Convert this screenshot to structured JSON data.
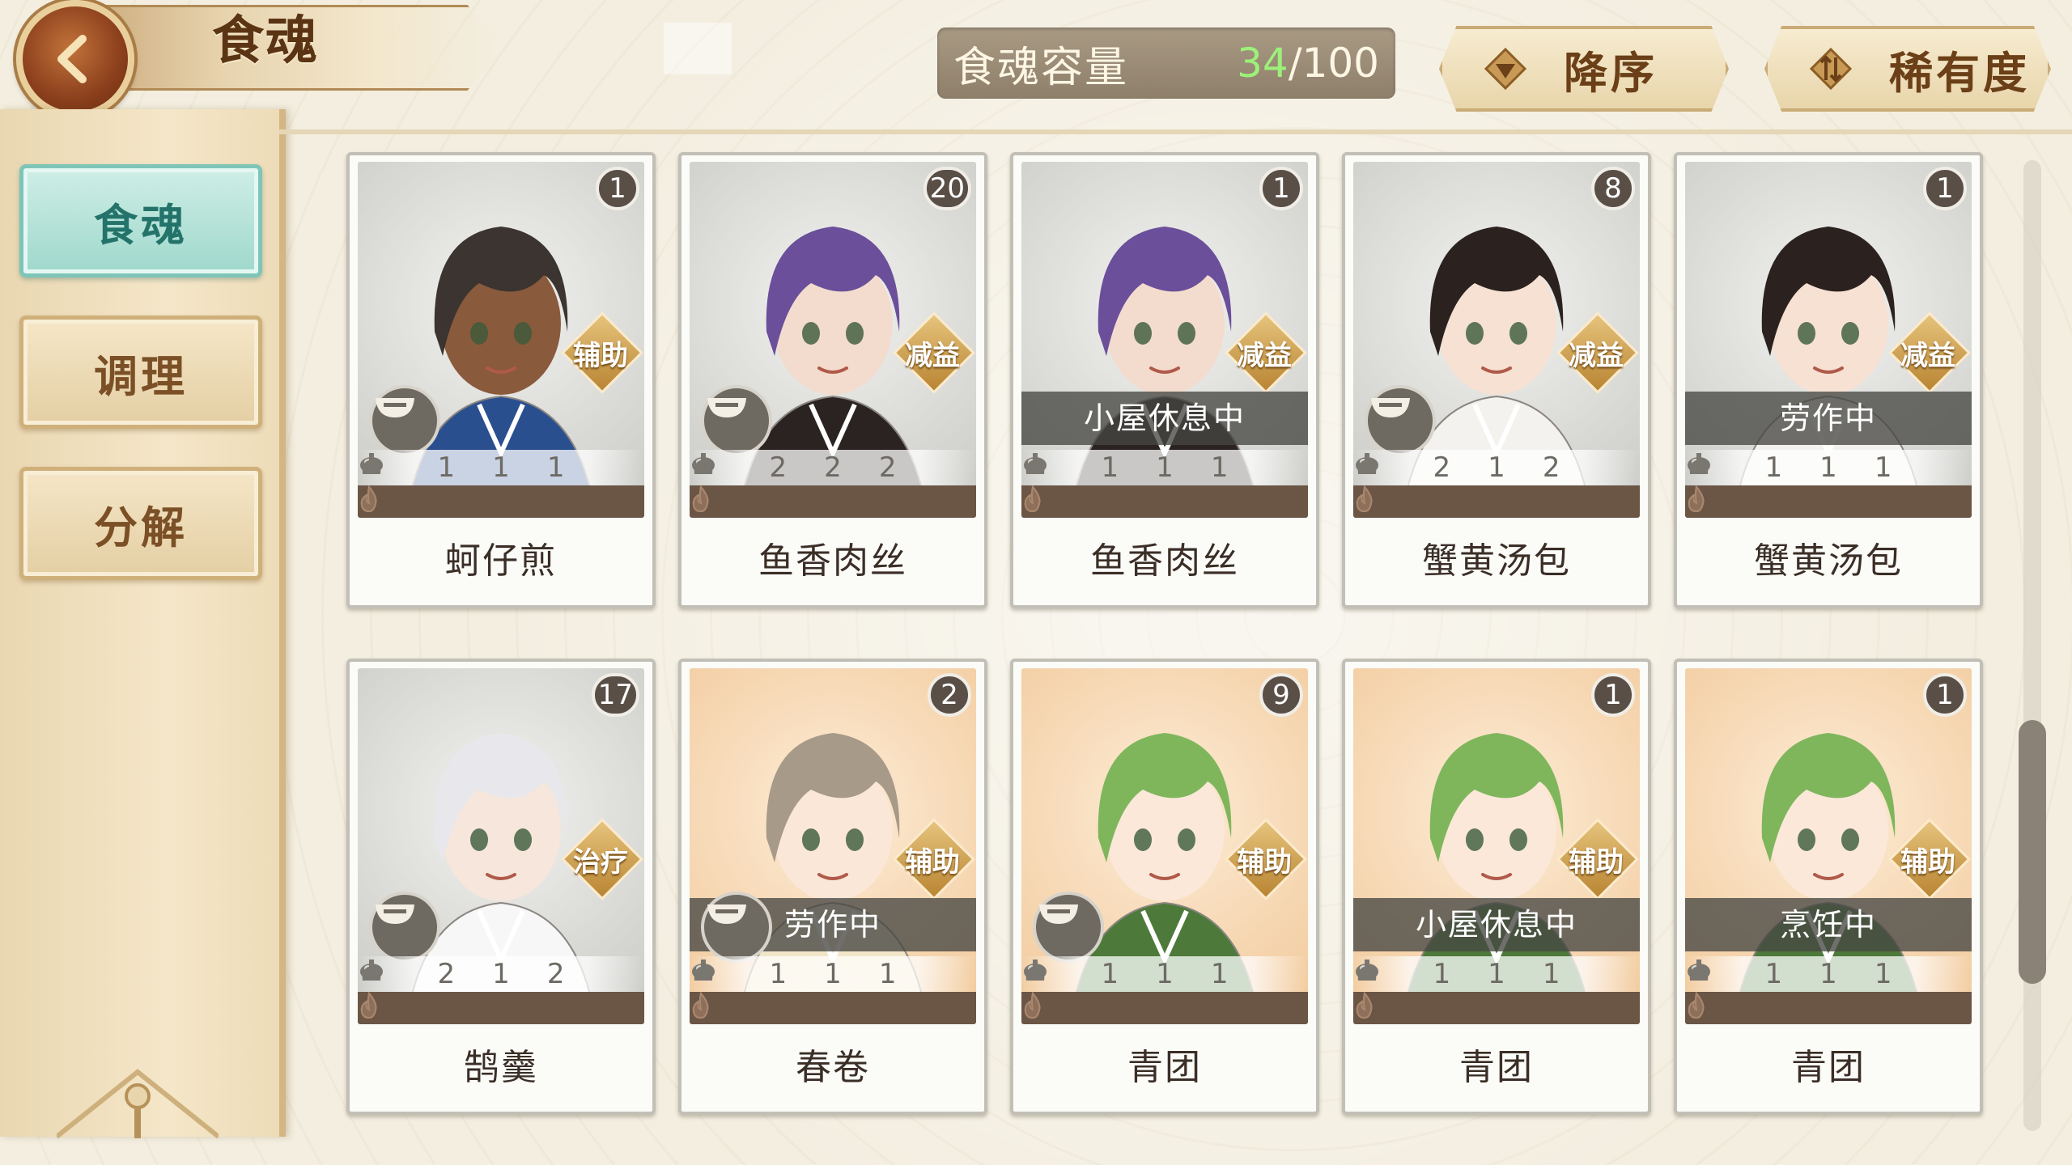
{
  "header": {
    "title": "食魂",
    "capacity_label": "食魂容量",
    "capacity_current": "34",
    "capacity_separator": "/",
    "capacity_max": "100",
    "sort_order_label": "降序",
    "sort_rarity_label": "稀有度"
  },
  "sidebar": {
    "items": [
      {
        "label": "食魂",
        "active": true
      },
      {
        "label": "调理",
        "active": false
      },
      {
        "label": "分解",
        "active": false
      }
    ]
  },
  "cards": [
    {
      "name": "蚵仔煎",
      "count": "1",
      "role": "辅助",
      "status": "",
      "bowl": true,
      "stats": [
        "1",
        "1",
        "1"
      ],
      "stars": 1,
      "art": "grey",
      "hair": "#3b3430",
      "skin": "#8a5a3c",
      "outfit": "#2a4f8f"
    },
    {
      "name": "鱼香肉丝",
      "count": "20",
      "role": "减益",
      "status": "",
      "bowl": true,
      "stats": [
        "2",
        "2",
        "2"
      ],
      "stars": 1,
      "art": "grey",
      "hair": "#6b4f9a",
      "skin": "#f3dccd",
      "outfit": "#2b2321"
    },
    {
      "name": "鱼香肉丝",
      "count": "1",
      "role": "减益",
      "status": "小屋休息中",
      "bowl": false,
      "stats": [
        "1",
        "1",
        "1"
      ],
      "stars": 1,
      "art": "grey",
      "hair": "#6b4f9a",
      "skin": "#f3dccd",
      "outfit": "#2b2321"
    },
    {
      "name": "蟹黄汤包",
      "count": "8",
      "role": "减益",
      "status": "",
      "bowl": true,
      "stats": [
        "2",
        "1",
        "2"
      ],
      "stars": 1,
      "art": "grey",
      "hair": "#2b2220",
      "skin": "#f6e1d3",
      "outfit": "#f4f2ee"
    },
    {
      "name": "蟹黄汤包",
      "count": "1",
      "role": "减益",
      "status": "劳作中",
      "bowl": false,
      "stats": [
        "1",
        "1",
        "1"
      ],
      "stars": 1,
      "art": "grey",
      "hair": "#2b2220",
      "skin": "#f6e1d3",
      "outfit": "#f4f2ee"
    },
    {
      "name": "鹄羹",
      "count": "17",
      "role": "治疗",
      "status": "",
      "bowl": true,
      "stats": [
        "2",
        "1",
        "2"
      ],
      "stars": 1,
      "art": "grey",
      "hair": "#e8e8ec",
      "skin": "#f6e6dc",
      "outfit": "#f7f7f7"
    },
    {
      "name": "春卷",
      "count": "2",
      "role": "辅助",
      "status": "劳作中",
      "bowl": true,
      "stats": [
        "1",
        "1",
        "1"
      ],
      "stars": 1,
      "art": "warm",
      "hair": "#a89a88",
      "skin": "#fbe7d8",
      "outfit": "#f2e6c8"
    },
    {
      "name": "青团",
      "count": "9",
      "role": "辅助",
      "status": "",
      "bowl": true,
      "stats": [
        "1",
        "1",
        "1"
      ],
      "stars": 1,
      "art": "warm",
      "hair": "#7fb65c",
      "skin": "#fbe8d9",
      "outfit": "#4d7a3a"
    },
    {
      "name": "青团",
      "count": "1",
      "role": "辅助",
      "status": "小屋休息中",
      "bowl": false,
      "stats": [
        "1",
        "1",
        "1"
      ],
      "stars": 1,
      "art": "warm",
      "hair": "#7fb65c",
      "skin": "#fbe8d9",
      "outfit": "#4d7a3a"
    },
    {
      "name": "青团",
      "count": "1",
      "role": "辅助",
      "status": "烹饪中",
      "bowl": false,
      "stats": [
        "1",
        "1",
        "1"
      ],
      "stars": 1,
      "art": "warm",
      "hair": "#7fb65c",
      "skin": "#fbe8d9",
      "outfit": "#4d7a3a"
    }
  ],
  "icons": {
    "back": "arrow-left-icon",
    "sort_order": "triangle-down-icon",
    "sort_rarity": "swap-arrows-icon",
    "bowl": "bowl-icon",
    "attack": "fist-icon",
    "defense": "teapot-icon",
    "star": "flame-icon"
  },
  "colors": {
    "capacity_current": "#9df07a",
    "active_tab": "#9fd8cc",
    "accent_brown": "#6b3f17"
  }
}
